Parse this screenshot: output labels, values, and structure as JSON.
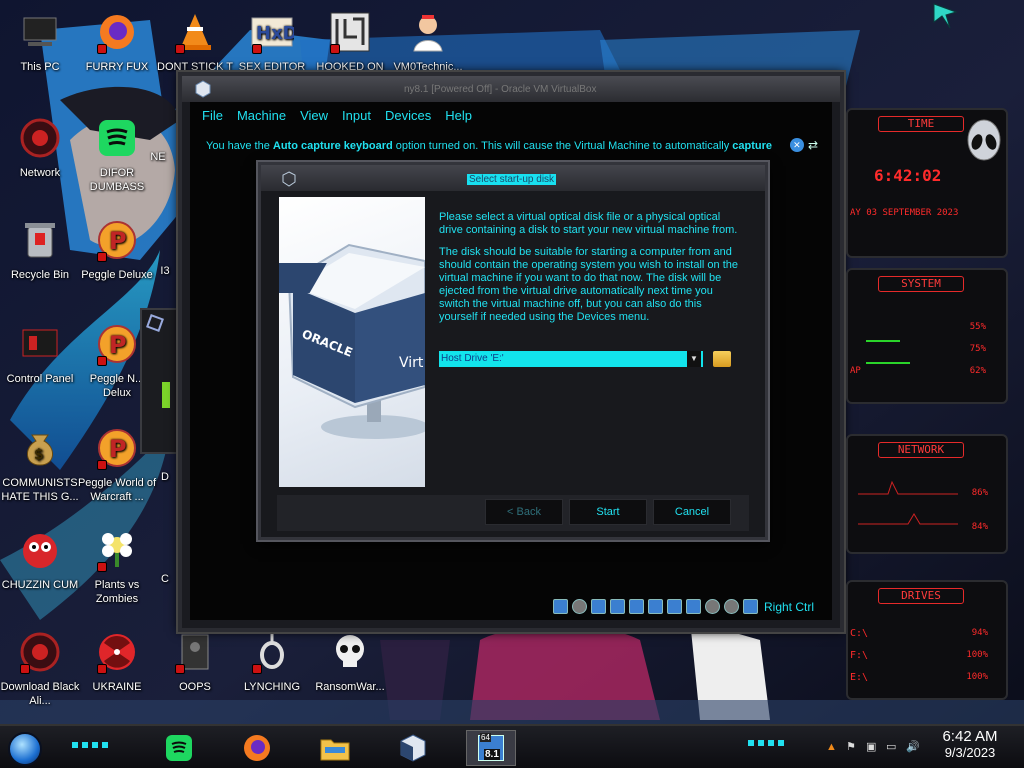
{
  "desktop": {
    "icons": [
      {
        "label": "This PC"
      },
      {
        "label": "FURRY FUX"
      },
      {
        "label": "DONT STICK T"
      },
      {
        "label": "SEX EDITOR"
      },
      {
        "label": "HOOKED ON"
      },
      {
        "label": "VM0Technic..."
      },
      {
        "label": "Network"
      },
      {
        "label": "DIFOR DUMBASS"
      },
      {
        "label": "NE"
      },
      {
        "label": "Recycle Bin"
      },
      {
        "label": "Peggle Deluxe"
      },
      {
        "label": "I3"
      },
      {
        "label": "Control Panel"
      },
      {
        "label": "Peggle N... Delux"
      },
      {
        "label": "COMMUNISTS HATE THIS G..."
      },
      {
        "label": "Peggle World of Warcraft ..."
      },
      {
        "label": "D"
      },
      {
        "label": "CHUZZIN CUM"
      },
      {
        "label": "Plants vs Zombies"
      },
      {
        "label": "C"
      },
      {
        "label": "Download Black Ali..."
      },
      {
        "label": "UKRAINE"
      },
      {
        "label": "OOPS"
      },
      {
        "label": "LYNCHING"
      },
      {
        "label": "RansomWar..."
      }
    ]
  },
  "vm_window": {
    "title": "ny8.1 [Powered Off] - Oracle VM VirtualBox",
    "menu": [
      "File",
      "Machine",
      "View",
      "Input",
      "Devices",
      "Help"
    ],
    "notice": {
      "prefix": "You have the ",
      "bold1": "Auto capture keyboard",
      "middle": " option turned on. This will cause the Virtual Machine to automatically ",
      "bold2": "capture"
    },
    "host_key": "Right Ctrl"
  },
  "dialog": {
    "title": "Select start-up disk",
    "paragraph1": "Please select a virtual optical disk file or a physical optical drive containing a disk to start your new virtual machine from.",
    "paragraph2": "The disk should be suitable for starting a computer from and should contain the operating system you wish to install on the virtual machine if you want to do that now. The disk will be ejected from the virtual drive automatically next time you switch the virtual machine off, but you can also do this yourself if needed using the Devices menu.",
    "selected_disk": "Host Drive 'E:'",
    "buttons": {
      "back": "< Back",
      "start": "Start",
      "cancel": "Cancel"
    },
    "logo_text_1": "ORACLE",
    "logo_text_2": "Virt"
  },
  "widgets": {
    "time": {
      "head": "TIME",
      "value": "6:42:02",
      "date": "AY 03 SEPTEMBER 2023"
    },
    "system": {
      "head": "SYSTEM",
      "readings": [
        "55%",
        "75%",
        "62%"
      ],
      "label": "AP"
    },
    "network": {
      "head": "NETWORK",
      "readings": [
        "86%",
        "84%"
      ]
    },
    "drives": {
      "head": "DRIVES",
      "rows": [
        {
          "drive": "C:\\",
          "pct": "94%"
        },
        {
          "drive": "F:\\",
          "pct": "100%"
        },
        {
          "drive": "E:\\",
          "pct": "100%"
        }
      ]
    }
  },
  "taskbar": {
    "clock_time": "6:42 AM",
    "clock_date": "9/3/2023",
    "vbox_badge_top": "64",
    "vbox_badge_bottom": "8.1"
  },
  "colors": {
    "accent_cyan": "#21e1f0",
    "widget_red": "#ff2b2b"
  }
}
